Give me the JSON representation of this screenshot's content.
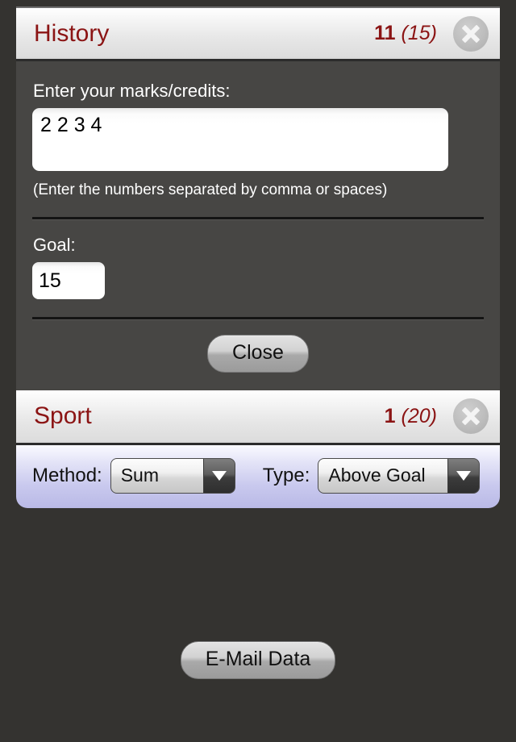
{
  "panels": [
    {
      "title": "History",
      "count_current": "11",
      "count_goal": "(15)",
      "close_icon": "close-circle-icon",
      "form": {
        "marks_label": "Enter your marks/credits:",
        "marks_value": "2 2 3 4",
        "marks_placeholder": "",
        "hint": "(Enter the numbers separated by comma or spaces)",
        "goal_label": "Goal:",
        "goal_value": "15",
        "goal_placeholder": "",
        "close_button": "Close"
      }
    },
    {
      "title": "Sport",
      "count_current": "1",
      "count_goal": "(20)",
      "close_icon": "close-circle-icon",
      "options": {
        "method_label": "Method:",
        "method_value": "Sum",
        "method_options": [
          "Sum"
        ],
        "type_label": "Type:",
        "type_value": "Above Goal",
        "type_options": [
          "Above Goal"
        ],
        "arrow_icon": "chevron-down-icon"
      }
    }
  ],
  "footer": {
    "email_button": "E-Mail Data"
  },
  "colors": {
    "title_red": "#8b1414",
    "page_background": "#343330",
    "panel_body": "#474644",
    "options_band": "#b9b9e6"
  }
}
